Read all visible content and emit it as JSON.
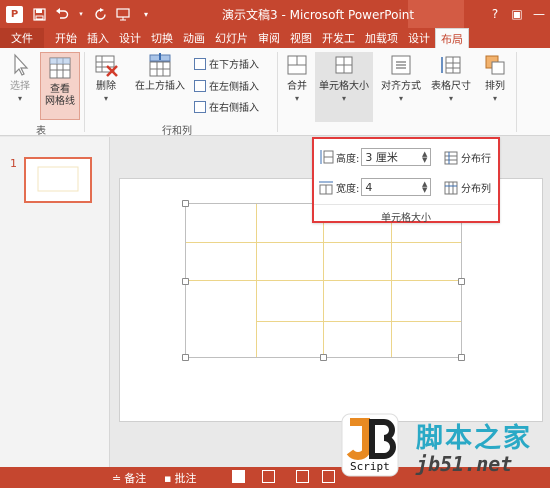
{
  "window": {
    "title": "演示文稿3 - Microsoft PowerPoint",
    "app_logo": "P"
  },
  "tabs": [
    "文件",
    "开始",
    "插入",
    "设计",
    "切换",
    "动画",
    "幻灯片",
    "审阅",
    "视图",
    "开发工",
    "加载项",
    "设计",
    "布局"
  ],
  "ribbon": {
    "table_group": {
      "select": "选择",
      "view_gridlines_line1": "查看",
      "view_gridlines_line2": "网格线",
      "label": "表"
    },
    "rows_cols_group": {
      "delete": "删除",
      "insert_above": "在上方插入",
      "insert_below": "在下方插入",
      "insert_left": "在左侧插入",
      "insert_right": "在右侧插入",
      "label": "行和列"
    },
    "merge": "合并",
    "cell_size": "单元格大小",
    "alignment": "对齐方式",
    "table_size": "表格尺寸",
    "arrange": "排列"
  },
  "popup": {
    "height_label": "高度:",
    "height_value": "3 厘米",
    "width_label": "宽度:",
    "width_value": "4",
    "distribute_rows": "分布行",
    "distribute_cols": "分布列",
    "group_label": "单元格大小"
  },
  "thumbnails": {
    "slide_number": "1"
  },
  "statusbar": {
    "notes": "备注",
    "comments": "批注"
  },
  "watermark": {
    "text_cn": "脚本之家",
    "url": "jb51.net",
    "script": "Script"
  },
  "colors": {
    "accent": "#c5462f",
    "highlight_border": "#e23a3a",
    "gridline": "#ecd58a"
  }
}
